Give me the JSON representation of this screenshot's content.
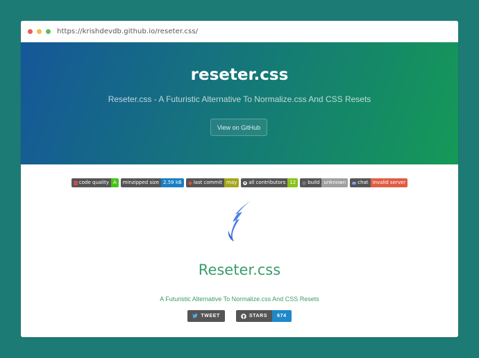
{
  "browser": {
    "url": "https://krishdevdb.github.io/reseter.css/",
    "dots": [
      "#ee5c57",
      "#f3be4f",
      "#5ac05a"
    ]
  },
  "hero": {
    "title": "reseter.css",
    "tagline": "Reseter.css - A Futuristic Alternative To Normalize.css And CSS Resets",
    "button_label": "View on GitHub",
    "gradient": [
      "#155799",
      "#159957"
    ]
  },
  "badges": [
    {
      "label": "code quality",
      "value": "A",
      "color": "#4ac41c",
      "icon": "codefactor-icon"
    },
    {
      "label": "minzipped size",
      "value": "2.59 kB",
      "color": "#1a7fc3",
      "icon": ""
    },
    {
      "label": "last commit",
      "value": "may",
      "color": "#a4a61d",
      "icon": "git-icon"
    },
    {
      "label": "all contributors",
      "value": "12",
      "color": "#8ac219",
      "icon": "github-icon"
    },
    {
      "label": "build",
      "value": "unknown",
      "color": "#9f9f9f",
      "icon": "build-icon"
    },
    {
      "label": "chat",
      "value": "invalid server",
      "color": "#e05d44",
      "icon": "discord-icon"
    }
  ],
  "project": {
    "title": "Reseter.css",
    "tagline": "A Futuristic Alternative To Normalize.css And CSS Resets",
    "accent": "#3a9d6b"
  },
  "social": {
    "tweet_label": "TWEET",
    "stars_label": "STARS",
    "stars_count": "674"
  }
}
